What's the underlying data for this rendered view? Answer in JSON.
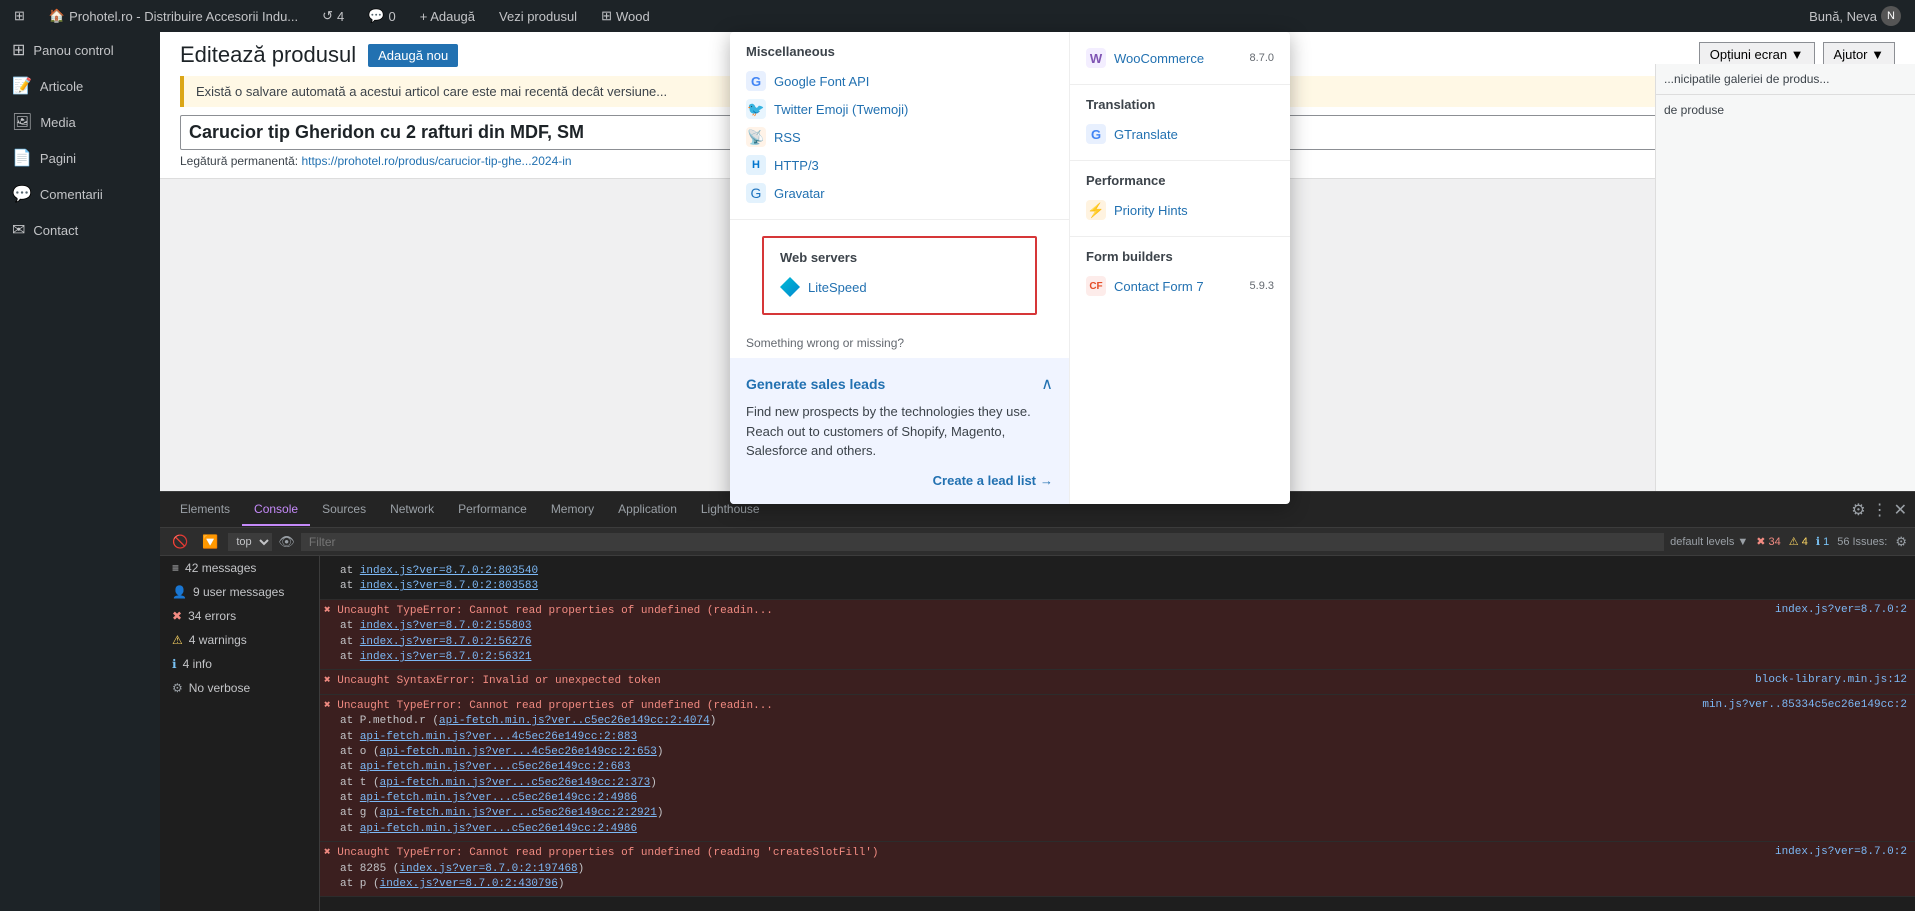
{
  "adminBar": {
    "wpLogoLabel": "⊞",
    "siteIcon": "🏠",
    "siteName": "Prohotel.ro - Distribuire Accesorii Indu...",
    "revisions": "4",
    "comments": "0",
    "addNewLabel": "+ Adaugă",
    "viewProductLabel": "Vezi produsul",
    "wooLabel": "Wood",
    "greetingLabel": "Bună, Neva",
    "userAvatar": "N"
  },
  "sidebar": {
    "items": [
      {
        "label": "Panou control",
        "icon": "⊞"
      },
      {
        "label": "Articole",
        "icon": "📝"
      },
      {
        "label": "Media",
        "icon": "🖼"
      },
      {
        "label": "Pagini",
        "icon": "📄"
      },
      {
        "label": "Comentarii",
        "icon": "💬"
      },
      {
        "label": "Contact",
        "icon": "✉"
      }
    ]
  },
  "pageHeader": {
    "title": "Editează produsul",
    "addNewButton": "Adaugă nou",
    "autosaveNotice": "Există o salvare automată a acestui articol care este mai recentă decât versiune...",
    "productTitle": "Carucior tip Gheridon cu 2 rafturi din MDF, SM",
    "permalink": "Legătură permanentă:",
    "permalinkUrl": "https://prohotel.ro/produs/carucior-tip-ghe...2024-in",
    "screenOptions": "Opțiuni ecran ▼",
    "help": "Ajutor ▼"
  },
  "devtools": {
    "tabs": [
      {
        "label": "Elements",
        "active": false
      },
      {
        "label": "Console",
        "active": true
      },
      {
        "label": "Sources",
        "active": false
      },
      {
        "label": "Network",
        "active": false
      },
      {
        "label": "Performance",
        "active": false
      },
      {
        "label": "Memory",
        "active": false
      },
      {
        "label": "Application",
        "active": false
      },
      {
        "label": "Lighthouse",
        "active": false
      }
    ],
    "toolbar": {
      "levelSelect": "top",
      "filterPlaceholder": "Filter"
    },
    "sidebar": {
      "items": [
        {
          "label": "42 messages",
          "icon": "≡",
          "type": "msg"
        },
        {
          "label": "9 user messages",
          "icon": "👤",
          "type": "msg"
        },
        {
          "label": "34 errors",
          "icon": "✖",
          "type": "error"
        },
        {
          "label": "4 warnings",
          "icon": "⚠",
          "type": "warning"
        },
        {
          "label": "4 info",
          "icon": "ℹ",
          "type": "info"
        },
        {
          "label": "No verbose",
          "icon": "⚙",
          "type": "msg"
        }
      ]
    },
    "logs": [
      {
        "type": "normal",
        "lines": [
          "    at index.js?ver=8.7.0:2:803540",
          "    at index.js?ver=8.7.0:2:803583"
        ],
        "file": ""
      },
      {
        "type": "error",
        "lines": [
          "✖ Uncaught TypeError: Cannot read properties of undefined (readin...",
          "    at index.js?ver=8.7.0:2:55803",
          "    at index.js?ver=8.7.0:2:56276",
          "    at index.js?ver=8.7.0:2:56321"
        ],
        "file": ""
      },
      {
        "type": "error",
        "lines": [
          "✖ Uncaught SyntaxError: Invalid or unexpected token"
        ],
        "file": ""
      },
      {
        "type": "error",
        "lines": [
          "✖ Uncaught TypeError: Cannot read properties of undefined (readin...",
          "    at P.method.r (api-fetch.min.js?ver..c5ec26e149cc:2:4074)",
          "    at api-fetch.min.js?ver...4c5ec26e149cc:2:883",
          "    at o (api-fetch.min.js?ver...4c5ec26e149cc:2:653)",
          "    at api-fetch.min.js?ver...c5ec26e149cc:2:683",
          "    at t (api-fetch.min.js?ver...c5ec26e149cc:2:373)",
          "    at api-fetch.min.js?ver...c5ec26e149cc:2:4986",
          "    at g (api-fetch.min.js?ver...c5ec26e149cc:2:2921)",
          "    at api-fetch.min.js?ver...c5ec26e149cc:2:4986"
        ],
        "file": ""
      },
      {
        "type": "error",
        "lines": [
          "✖ Uncaught TypeError: Cannot read properties of undefined (reading 'createSlotFill')",
          "    at 8285 (index.js?ver=8.7.0:2:197468)",
          "    at p (index.js?ver=8.7.0:2:430796)"
        ],
        "file": "index.js?ver=8.7.0:2"
      }
    ],
    "rightPanel": {
      "issuesLabel": "56 Issues:",
      "errorCount": "✖ 34",
      "warningCount": "⚠ 4",
      "infoCount": "ℹ 1",
      "defaultLevels": "default levels ▼"
    },
    "fileLinks": {
      "file1": "index.js?ver=8.7.0:2",
      "file2": "block-library.min.js:12",
      "file3": "min.js?ver..85334c5ec26e149cc:2",
      "file4": "index.js?ver=8.7.0:2"
    }
  },
  "popup": {
    "miscellaneous": {
      "title": "Miscellaneous",
      "items": [
        {
          "label": "Google Font API",
          "icon": "G",
          "iconColor": "#4285f4"
        },
        {
          "label": "Twitter Emoji (Twemoji)",
          "icon": "🐦",
          "iconColor": "#1da1f2"
        },
        {
          "label": "RSS",
          "icon": "📡",
          "iconColor": "#f26522"
        },
        {
          "label": "HTTP/3",
          "icon": "H",
          "iconColor": "#0076ce"
        },
        {
          "label": "Gravatar",
          "icon": "G",
          "iconColor": "#1e73be"
        }
      ]
    },
    "webServers": {
      "title": "Web servers",
      "items": [
        {
          "label": "LiteSpeed",
          "icon": "◇",
          "iconColor": "#00bcd4"
        }
      ]
    },
    "somethingWrong": "Something wrong or missing?",
    "salesLeads": {
      "title": "Generate sales leads",
      "description": "Find new prospects by the technologies they use. Reach out to customers of Shopify, Magento, Salesforce and others.",
      "createLeadLink": "Create a lead list",
      "arrowIcon": "→"
    },
    "rightColumn": {
      "wooCommerce": {
        "title": "WooCommerce",
        "version": "8.7.0",
        "icon": "W"
      },
      "translation": {
        "title": "Translation",
        "items": [
          {
            "label": "GTranslate",
            "icon": "G",
            "iconColor": "#4285f4"
          }
        ]
      },
      "performance": {
        "title": "Performance",
        "items": [
          {
            "label": "Priority Hints",
            "icon": "⚡",
            "iconColor": "#f57c00"
          }
        ]
      },
      "formBuilders": {
        "title": "Form builders",
        "items": [
          {
            "label": "Contact Form 7",
            "version": "5.9.3",
            "icon": "CF",
            "iconColor": "#e44d26"
          }
        ]
      }
    }
  }
}
